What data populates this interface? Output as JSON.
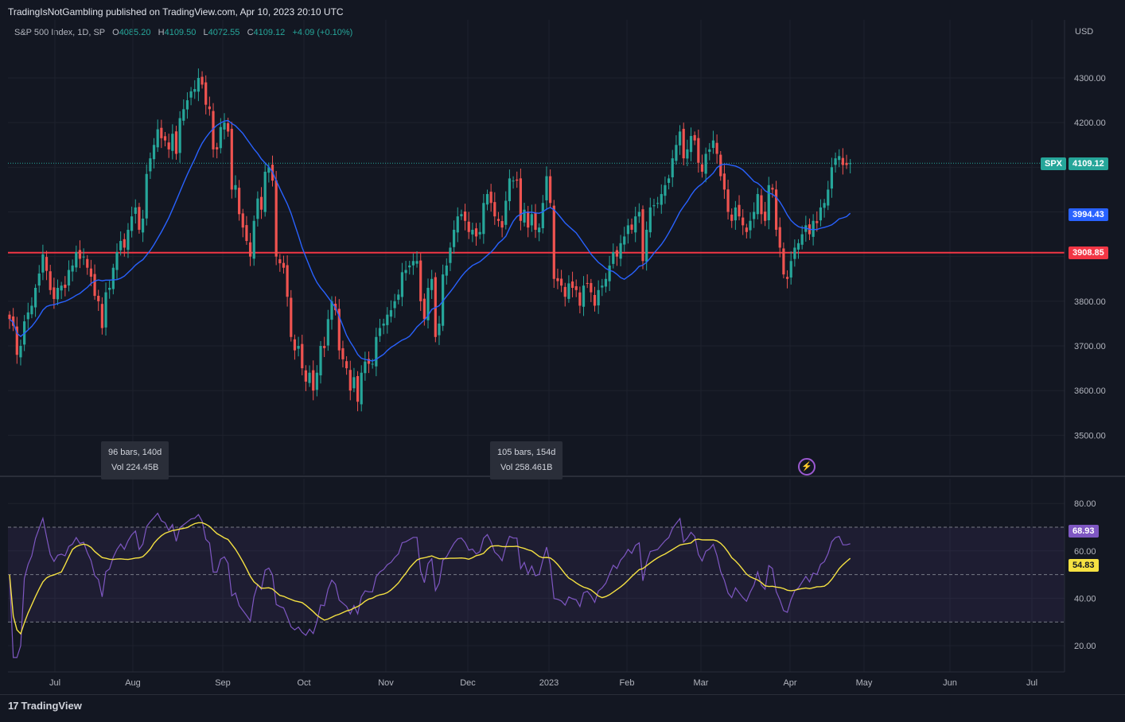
{
  "header": {
    "published": "TradingIsNotGambling published on TradingView.com, Apr 10, 2023 20:10 UTC"
  },
  "legend": {
    "symbol": "S&P 500 Index, 1D, SP",
    "o_label": "O",
    "o": "4085.20",
    "h_label": "H",
    "h": "4109.50",
    "l_label": "L",
    "l": "4072.55",
    "c_label": "C",
    "c": "4109.12",
    "change": "+4.09 (+0.10%)"
  },
  "axis": {
    "currency": "USD"
  },
  "price_tags": {
    "spx_label": "SPX",
    "spx": "4109.12",
    "ma": "3994.43",
    "level": "3908.85",
    "rsi": "68.93",
    "rsi_ma": "54.83"
  },
  "range_boxes": [
    {
      "bars": "96 bars, 140d",
      "vol": "Vol 224.45B"
    },
    {
      "bars": "105 bars, 154d",
      "vol": "Vol 258.461B"
    }
  ],
  "footer": {
    "logo": "TradingView",
    "logo_mark": "17"
  },
  "colors": {
    "up": "#26a69a",
    "down": "#ef5350",
    "ma": "#2962ff",
    "level": "#f23645",
    "rsi": "#7e57c2",
    "rsi_ma": "#f5e142"
  },
  "chart_data": [
    {
      "type": "candlestick",
      "title": "S&P 500 Index, 1D, SP",
      "ylim": [
        3420,
        4400
      ],
      "yticks": [
        3500,
        3600,
        3700,
        3800,
        3900,
        4000,
        4100,
        4200,
        4300
      ],
      "ytick_labels": [
        "3500.00",
        "3600.00",
        "3700.00",
        "3800.00",
        "",
        "",
        "",
        "4200.00",
        "4300.00"
      ],
      "xticks": [
        "Jul",
        "Aug",
        "Sep",
        "Oct",
        "Nov",
        "Dec",
        "2023",
        "Feb",
        "Mar",
        "Apr",
        "May",
        "Jun",
        "Jul"
      ],
      "horizontal_level": 3908.85,
      "last_close": 4109.12,
      "close": [
        3760,
        3745,
        3680,
        3700,
        3755,
        3775,
        3790,
        3830,
        3862,
        3905,
        3868,
        3825,
        3805,
        3830,
        3835,
        3830,
        3870,
        3880,
        3910,
        3895,
        3900,
        3875,
        3855,
        3812,
        3800,
        3740,
        3820,
        3830,
        3875,
        3910,
        3935,
        3920,
        3960,
        3990,
        4010,
        3960,
        3985,
        4085,
        4120,
        4150,
        4185,
        4165,
        4160,
        4140,
        4175,
        4130,
        4210,
        4230,
        4250,
        4270,
        4275,
        4300,
        4285,
        4240,
        4230,
        4140,
        4140,
        4190,
        4200,
        4180,
        4050,
        4060,
        3995,
        3965,
        3935,
        3900,
        3980,
        4030,
        4005,
        4090,
        4100,
        4070,
        3900,
        3885,
        3875,
        3810,
        3720,
        3690,
        3700,
        3650,
        3620,
        3640,
        3600,
        3640,
        3700,
        3695,
        3760,
        3800,
        3780,
        3690,
        3670,
        3650,
        3600,
        3630,
        3575,
        3640,
        3665,
        3660,
        3660,
        3720,
        3740,
        3750,
        3770,
        3780,
        3800,
        3815,
        3865,
        3870,
        3880,
        3890,
        3890,
        3800,
        3760,
        3830,
        3850,
        3720,
        3750,
        3860,
        3880,
        3920,
        3960,
        3990,
        3995,
        3980,
        3955,
        3960,
        3945,
        3955,
        4020,
        4040,
        4020,
        3990,
        3980,
        3965,
        4025,
        4075,
        4070,
        4070,
        3980,
        4005,
        3965,
        3995,
        3960,
        3965,
        4020,
        4080,
        4020,
        3850,
        3845,
        3835,
        3810,
        3840,
        3830,
        3825,
        3790,
        3835,
        3840,
        3820,
        3790,
        3825,
        3835,
        3850,
        3880,
        3910,
        3900,
        3930,
        3945,
        3970,
        3960,
        3990,
        4000,
        3890,
        3960,
        4010,
        4015,
        4020,
        4040,
        4060,
        4075,
        4120,
        4150,
        4180,
        4120,
        4140,
        4170,
        4160,
        4110,
        4090,
        4130,
        4140,
        4160,
        4130,
        4080,
        4050,
        4000,
        3980,
        4010,
        3990,
        3970,
        3955,
        3980,
        4000,
        4040,
        3995,
        3980,
        4060,
        4050,
        3960,
        3920,
        3860,
        3850,
        3890,
        3920,
        3930,
        3950,
        3970,
        3950,
        3980,
        3975,
        4010,
        4020,
        4050,
        4100,
        4120,
        4125,
        4105,
        4105,
        4109
      ]
    },
    {
      "type": "line",
      "name": "RSI",
      "ylim": [
        12,
        88
      ],
      "yticks": [
        20,
        40,
        60,
        80
      ],
      "ytick_labels": [
        "20.00",
        "40.00",
        "60.00",
        "80.00"
      ],
      "bands": [
        30,
        50,
        70
      ],
      "rsi_last": 68.93,
      "rsi_ma_last": 54.83
    }
  ]
}
